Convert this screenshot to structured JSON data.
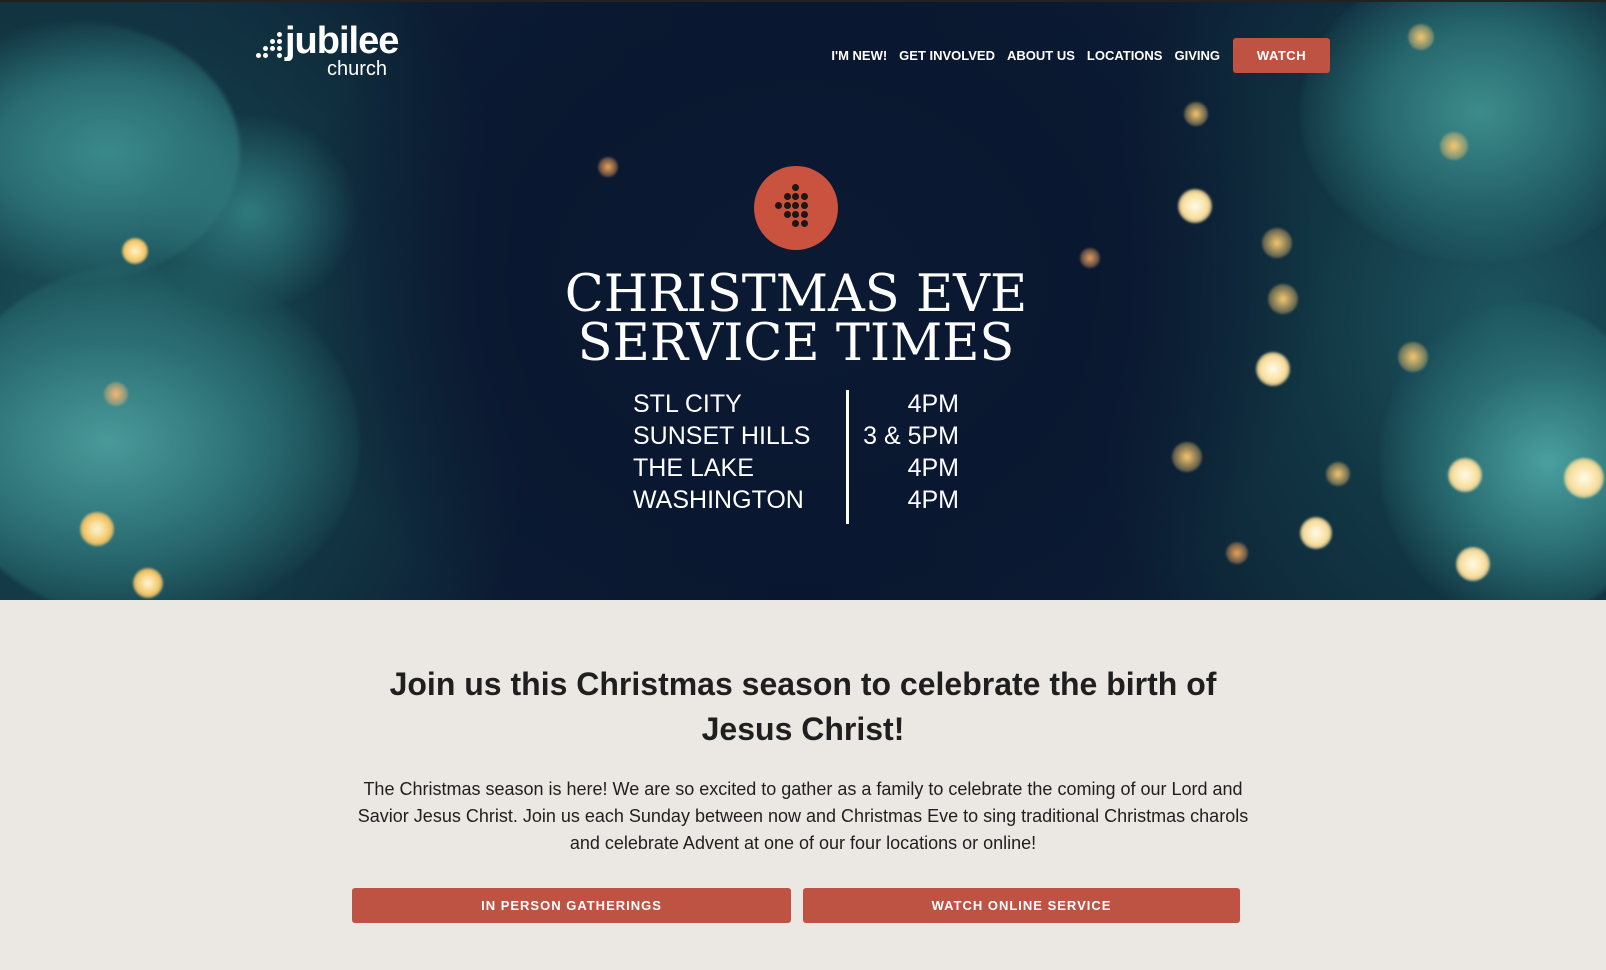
{
  "header": {
    "logo": {
      "word": "jubilee",
      "sub": "church"
    },
    "nav": [
      "I'M NEW!",
      "GET INVOLVED",
      "ABOUT US",
      "LOCATIONS",
      "GIVING"
    ],
    "watch_label": "WATCH"
  },
  "hero": {
    "title_line1": "CHRISTMAS EVE",
    "title_line2": "SERVICE TIMES",
    "services": [
      {
        "location": "STL CITY",
        "time": "4PM"
      },
      {
        "location": "SUNSET HILLS",
        "time": "3 & 5PM"
      },
      {
        "location": "THE LAKE",
        "time": "4PM"
      },
      {
        "location": "WASHINGTON",
        "time": "4PM"
      }
    ]
  },
  "content": {
    "title": "Join us this Christmas season to celebrate the birth of Jesus Christ!",
    "body": "The Christmas season is here! We are so excited to gather as a family to celebrate the coming of our Lord and Savior Jesus Christ. Join us each Sunday between now and Christmas Eve to sing traditional Christmas charols and celebrate Advent at one of our four locations or online!",
    "buttons": {
      "in_person": "IN PERSON GATHERINGS",
      "watch_online": "WATCH ONLINE SERVICE"
    }
  },
  "colors": {
    "accent": "#bf5343",
    "badge": "#c9533f",
    "page_bg": "#ebe7e2",
    "hero_bg": "#0a1730"
  }
}
